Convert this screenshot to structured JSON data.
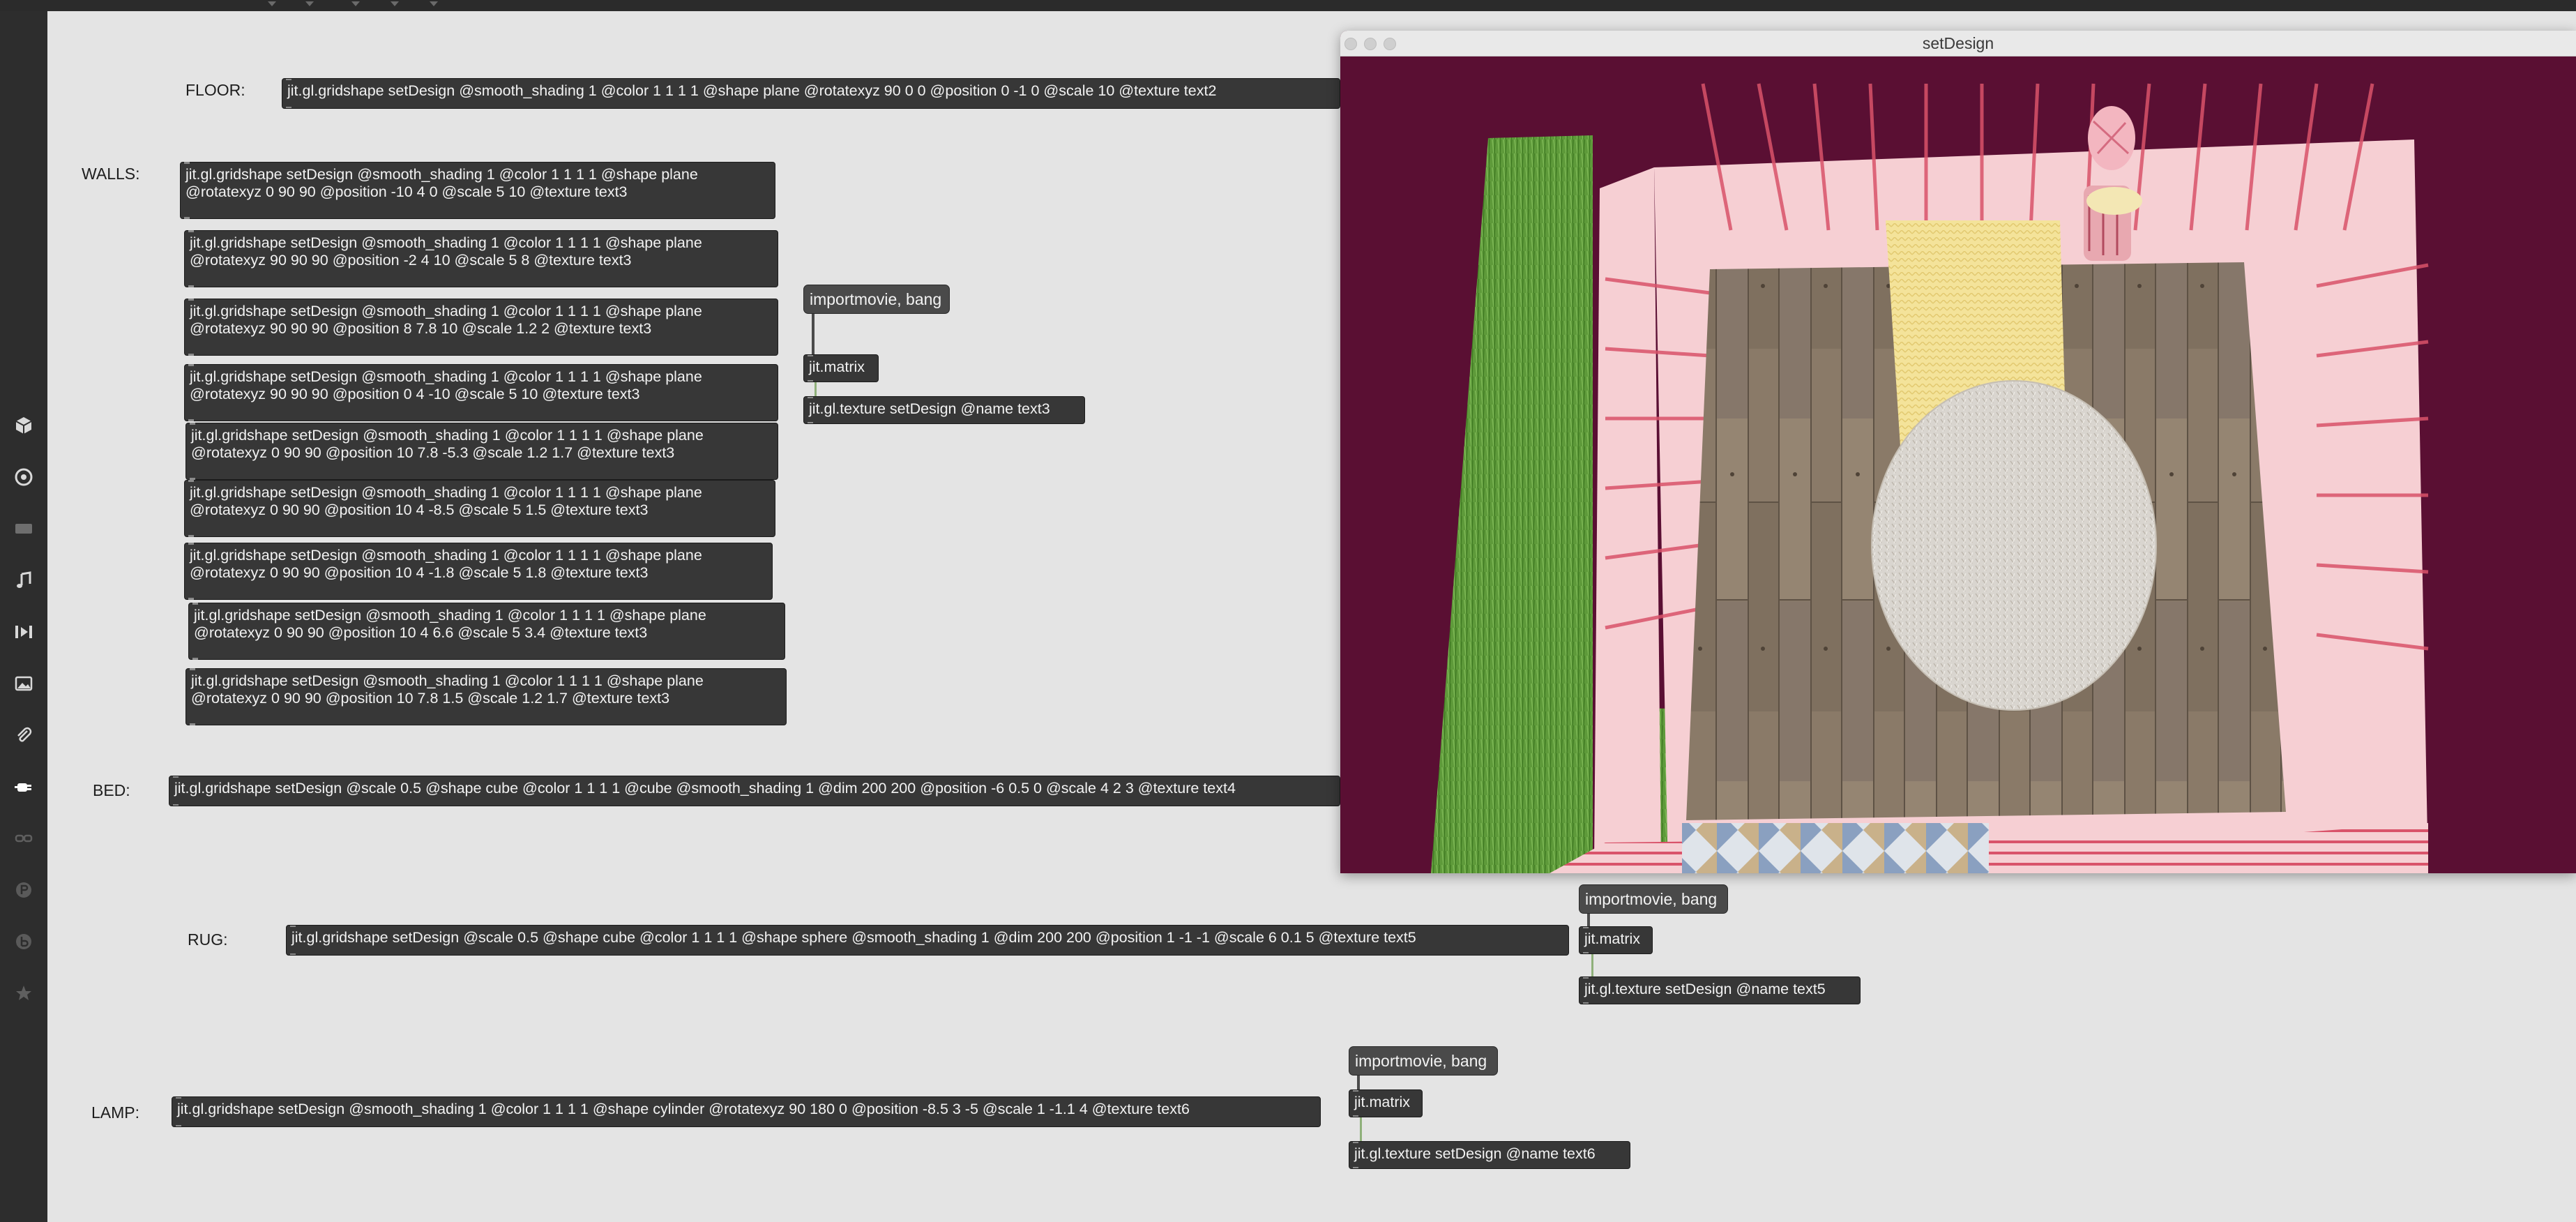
{
  "patch": {
    "labels": {
      "floor": "FLOOR:",
      "walls": "WALLS:",
      "bed": "BED:",
      "rug": "RUG:",
      "lamp": "LAMP:"
    },
    "floor_object": "jit.gl.gridshape setDesign @smooth_shading 1 @color 1 1 1 1 @shape plane @rotatexyz 90 0 0 @position 0 -1 0 @scale 10 @texture text2",
    "walls_objects": [
      "jit.gl.gridshape setDesign @smooth_shading 1 @color 1 1 1 1 @shape plane\n@rotatexyz 0 90 90 @position -10 4 0 @scale 5 10 @texture text3",
      "jit.gl.gridshape setDesign @smooth_shading 1 @color 1 1 1 1 @shape plane\n@rotatexyz 90 90 90 @position -2 4 10 @scale 5 8 @texture text3",
      "jit.gl.gridshape setDesign @smooth_shading 1 @color 1 1 1 1 @shape plane\n@rotatexyz 90 90 90 @position 8 7.8 10 @scale 1.2 2 @texture text3",
      "jit.gl.gridshape setDesign @smooth_shading 1 @color 1 1 1 1 @shape plane\n@rotatexyz 90 90 90 @position 0 4 -10 @scale 5 10 @texture text3",
      "jit.gl.gridshape setDesign @smooth_shading 1 @color 1 1 1 1 @shape plane\n@rotatexyz 0 90 90 @position 10 7.8 -5.3 @scale 1.2 1.7 @texture text3",
      "jit.gl.gridshape setDesign @smooth_shading 1 @color 1 1 1 1 @shape plane\n@rotatexyz 0 90 90 @position 10 4 -8.5 @scale 5 1.5 @texture text3",
      "jit.gl.gridshape setDesign @smooth_shading 1 @color 1 1 1 1 @shape plane\n@rotatexyz 0 90 90 @position 10 4 -1.8 @scale 5 1.8 @texture text3",
      "jit.gl.gridshape setDesign @smooth_shading 1 @color 1 1 1 1 @shape plane\n@rotatexyz 0 90 90 @position 10 4 6.6 @scale 5 3.4 @texture text3",
      "jit.gl.gridshape setDesign @smooth_shading 1 @color 1 1 1 1 @shape plane\n@rotatexyz 0 90 90 @position 10 7.8 1.5 @scale 1.2 1.7 @texture text3"
    ],
    "bed_object": "jit.gl.gridshape setDesign @scale 0.5 @shape cube @color 1 1 1 1 @cube @smooth_shading 1 @dim 200 200 @position -6 0.5 0 @scale 4 2 3 @texture text4",
    "rug_object": "jit.gl.gridshape setDesign @scale 0.5 @shape cube @color 1 1 1 1 @shape sphere @smooth_shading 1 @dim 200 200 @position 1 -1 -1 @scale 6 0.1 5 @texture text5",
    "lamp_object": "jit.gl.gridshape setDesign @smooth_shading 1 @color 1 1 1 1 @shape cylinder @rotatexyz 90 180 0 @position -8.5 3 -5 @scale 1 -1.1 4 @texture text6",
    "texture_chains": [
      {
        "message": "importmovie, bang",
        "matrix": "jit.matrix",
        "texture": "jit.gl.texture setDesign @name text3"
      },
      {
        "message": "importmovie, bang",
        "matrix": "jit.matrix",
        "texture": "jit.gl.texture setDesign @name text5"
      },
      {
        "message": "importmovie, bang",
        "matrix": "jit.matrix",
        "texture": "jit.gl.texture setDesign @name text6"
      }
    ]
  },
  "viewer": {
    "title": "setDesign",
    "background": "#5a0f33"
  },
  "sidebar": {
    "icons": [
      "cube-icon",
      "target-icon",
      "film-icon",
      "music-note-icon",
      "playlist-icon",
      "image-icon",
      "paperclip-icon",
      "plugin-icon",
      "link-icon",
      "p-icon",
      "b-icon",
      "star-icon"
    ]
  },
  "colors": {
    "object_bg": "#373737",
    "message_bg": "#4a4a4a",
    "canvas_bg": "#e4e4e4",
    "sidebar_bg": "#2d2d2d",
    "wall_pink": "#f6cfd3",
    "stripe_red": "#d9536a",
    "floor_wood": "#8d7d6c",
    "bed_yellow": "#f4e39a",
    "rug_white": "#d9d5cf",
    "grass_green": "#5e9a3a"
  }
}
